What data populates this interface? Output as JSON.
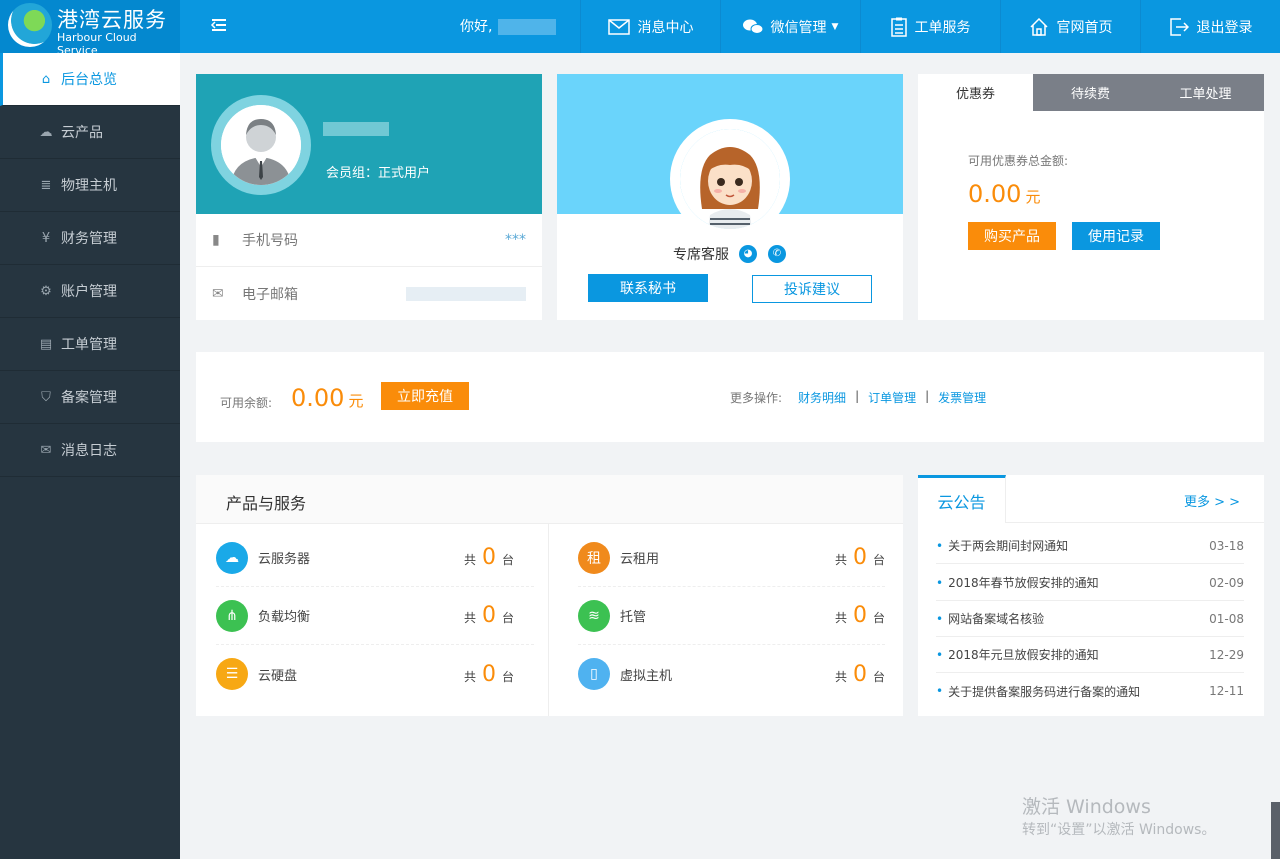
{
  "header": {
    "brand_title": "港湾云服务",
    "brand_subtitle": "Harbour Cloud Service",
    "greeting": "你好,",
    "nav": [
      {
        "label": "消息中心",
        "icon": "mail-icon"
      },
      {
        "label": "微信管理",
        "icon": "wechat-icon"
      },
      {
        "label": "工单服务",
        "icon": "clipboard-icon"
      },
      {
        "label": "官网首页",
        "icon": "home-icon"
      },
      {
        "label": "退出登录",
        "icon": "logout-icon"
      }
    ]
  },
  "sidebar": {
    "items": [
      {
        "label": "后台总览",
        "icon": "home-icon"
      },
      {
        "label": "云产品",
        "icon": "cloud-icon"
      },
      {
        "label": "物理主机",
        "icon": "server-icon"
      },
      {
        "label": "财务管理",
        "icon": "yen-icon"
      },
      {
        "label": "账户管理",
        "icon": "gear-icon"
      },
      {
        "label": "工单管理",
        "icon": "clipboard-icon"
      },
      {
        "label": "备案管理",
        "icon": "shield-icon"
      },
      {
        "label": "消息日志",
        "icon": "mail-icon"
      }
    ]
  },
  "profile": {
    "member_group": "会员组：正式用户",
    "phone_label": "手机号码",
    "phone_value": "***",
    "email_label": "电子邮箱"
  },
  "service": {
    "label": "专席客服",
    "contact_button": "联系秘书",
    "complaint_button": "投诉建议"
  },
  "coupon": {
    "tabs": [
      "优惠券",
      "待续费",
      "工单处理"
    ],
    "total_label": "可用优惠券总金额:",
    "amount": "0.00",
    "unit": "元",
    "buy_button": "购买产品",
    "history_button": "使用记录"
  },
  "balance": {
    "label": "可用余额:",
    "amount": "0.00",
    "unit": "元",
    "recharge_button": "立即充值",
    "more_label": "更多操作:",
    "links": [
      "财务明细",
      "订单管理",
      "发票管理"
    ]
  },
  "products": {
    "title": "产品与服务",
    "count_prefix": "共",
    "count_suffix": "台",
    "items": [
      {
        "name": "云服务器",
        "count": "0",
        "icon": "cloud-server-icon",
        "color": "#1aa9e8"
      },
      {
        "name": "云租用",
        "count": "0",
        "icon": "rent-icon",
        "color": "#f08a1c"
      },
      {
        "name": "负载均衡",
        "count": "0",
        "icon": "load-balance-icon",
        "color": "#3cc152"
      },
      {
        "name": "托管",
        "count": "0",
        "icon": "hosting-icon",
        "color": "#3cc152"
      },
      {
        "name": "云硬盘",
        "count": "0",
        "icon": "disk-icon",
        "color": "#f7a814"
      },
      {
        "name": "虚拟主机",
        "count": "0",
        "icon": "virtual-host-icon",
        "color": "#4fb2f0"
      }
    ]
  },
  "notices": {
    "title": "云公告",
    "more": "更多 > >",
    "items": [
      {
        "title": "关于两会期间封网通知",
        "date": "03-18"
      },
      {
        "title": "2018年春节放假安排的通知",
        "date": "02-09"
      },
      {
        "title": "网站备案域名核验",
        "date": "01-08"
      },
      {
        "title": "2018年元旦放假安排的通知",
        "date": "12-29"
      },
      {
        "title": "关于提供备案服务码进行备案的通知",
        "date": "12-11"
      }
    ]
  },
  "watermark": {
    "line1": "激活 Windows",
    "line2": "转到“设置”以激活 Windows。"
  }
}
